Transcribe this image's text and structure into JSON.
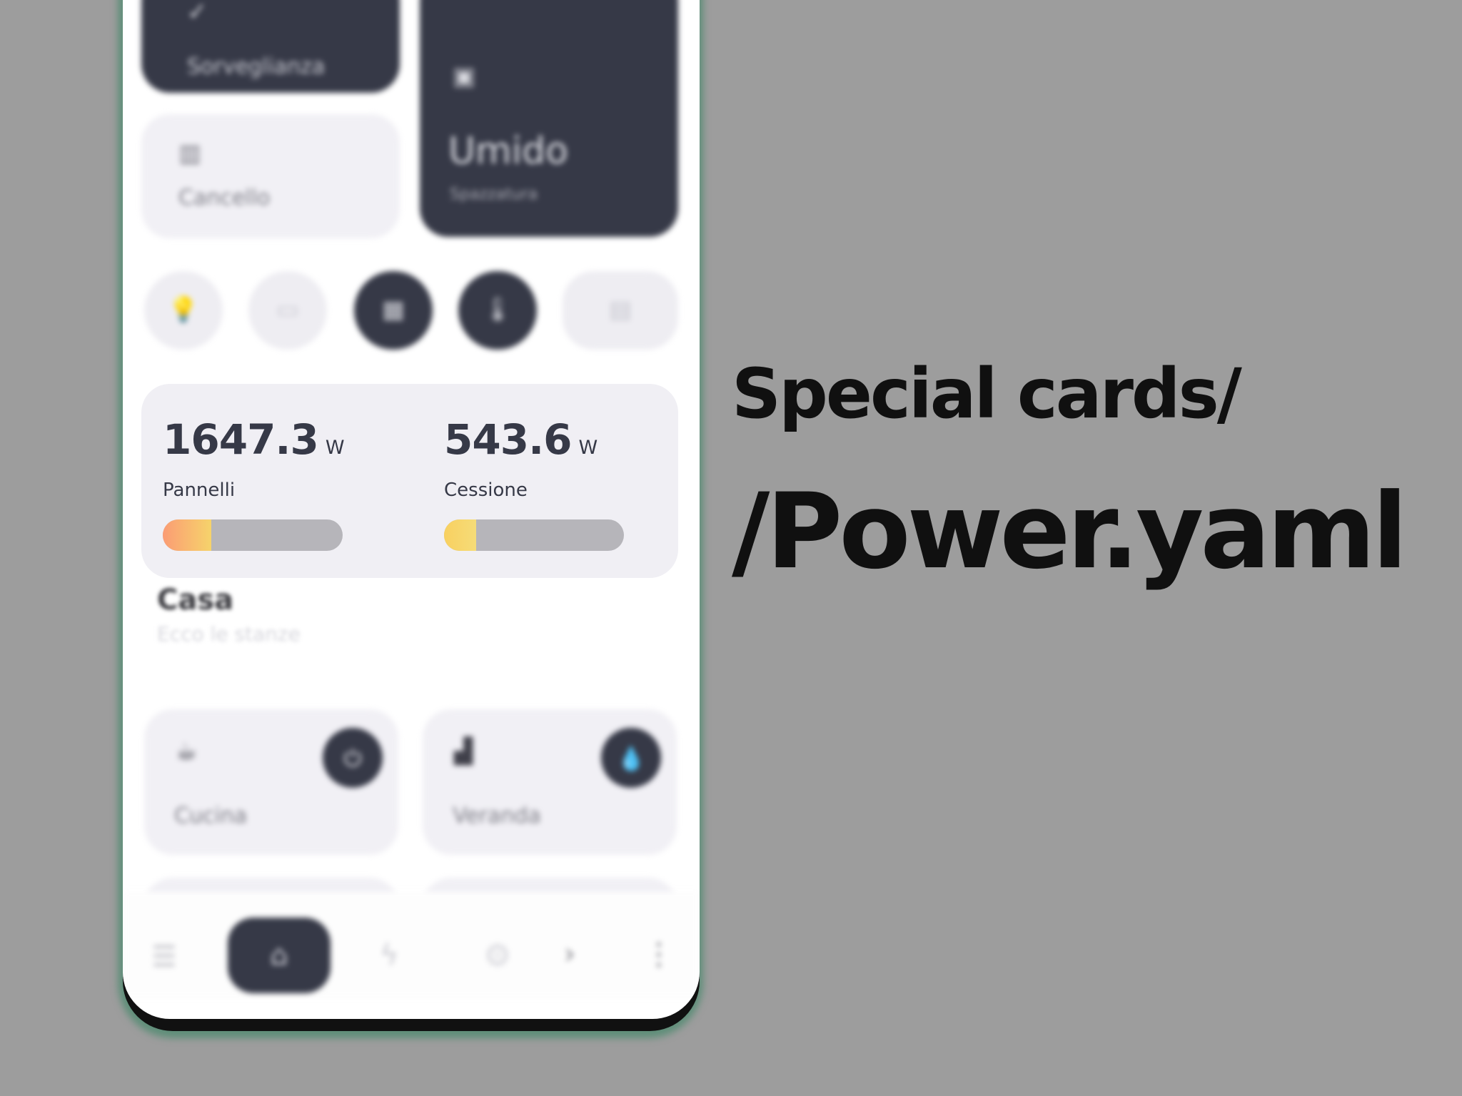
{
  "headline": {
    "line1": "Special cards/",
    "line2": "/Power.yaml"
  },
  "tiles": {
    "sorveglianza": {
      "label": "Sorveglianza",
      "icon": "shield-check-icon"
    },
    "cancello": {
      "label": "Cancello",
      "icon": "gate-icon"
    },
    "umido": {
      "title": "Umido",
      "subtitle": "Spazzatura",
      "icon": "trash-bin-icon"
    }
  },
  "quick_chips": [
    {
      "icon": "lightbulb-icon",
      "active": false
    },
    {
      "icon": "monitor-icon",
      "active": false
    },
    {
      "icon": "calendar-icon",
      "active": true
    },
    {
      "icon": "thermometer-icon",
      "active": true
    },
    {
      "icon": "document-icon",
      "active": false
    }
  ],
  "power": {
    "pannelli": {
      "value": "1647.3",
      "unit": "W",
      "label": "Pannelli",
      "fill_fraction": 0.27,
      "gradient": [
        "#fb9c74",
        "#f6d36b"
      ]
    },
    "cessione": {
      "value": "543.6",
      "unit": "W",
      "label": "Cessione",
      "fill_fraction": 0.18,
      "gradient": [
        "#f8d060",
        "#f6dc78"
      ]
    }
  },
  "section": {
    "title": "Casa",
    "subtitle": "Ecco le stanze"
  },
  "rooms": [
    {
      "label": "Cucina",
      "icon": "coffee-cup-icon",
      "action_icon": "plug-icon"
    },
    {
      "label": "Veranda",
      "icon": "sofa-icon",
      "action_icon": "drop-icon"
    }
  ],
  "colors": {
    "background": "#9d9d9d",
    "dark_card": "#363947",
    "light_card": "#f0eff4",
    "bar_track": "#b6b5ba",
    "phone_frame": "#5f8e79"
  }
}
